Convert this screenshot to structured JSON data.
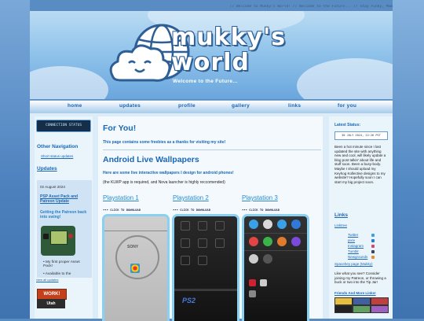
{
  "ticker": "//   Welcome to Mukky's World!   //   Welcome to the Future...   //   Stay Funky, Mam",
  "banner": {
    "logo_line1": "mukky's",
    "logo_line2": "world",
    "tagline": "Welcome to the Future..."
  },
  "nav": [
    "home",
    "updates",
    "profile",
    "gallery",
    "links",
    "for you"
  ],
  "left": {
    "status_button": "CONNECTION STATUS",
    "other_nav_heading": "Other Navigation",
    "other_nav_link": "Short status updates",
    "updates_heading": "Updates",
    "update_date": "02 August 2024",
    "update_title": "PSP Asset Pack and Patreon Update",
    "update_desc": "Getting the Patreon back into swing!",
    "update_items": [
      "My first proper Asset Pack!",
      "Available to the"
    ],
    "view_all": "view all updates",
    "badge_work": "WORK!",
    "badge_utah": "Utah"
  },
  "main": {
    "title": "For You!",
    "subtitle": "This page contains some freebies as a thanks for visiting my site!",
    "section_title": "Android Live Wallpapers",
    "section_desc": "Here are some live interactive wallpapers I design for android phones!",
    "section_note": "(the KLWP app is required, and Nova launcher is highly reccomended)",
    "wallpapers": [
      {
        "title": "Playstation 1",
        "download": "••• CLICK TO DOWNLOAD"
      },
      {
        "title": "Playstation 2",
        "download": "••• CLICK TO DOWNLOAD"
      },
      {
        "title": "Playstation 3",
        "download": "••• CLICK TO DOWNLOAD"
      }
    ],
    "ps1_brand": "SONY",
    "ps2_brand": "PS2"
  },
  "right": {
    "latest_status": "Latest Status:",
    "status_box": "30 JULY 2024, 22:26 PST",
    "status_text": "Been a hot minute since I last updated the site with anything new and cool, will likely update a blog post talkin' about life and stuff soon. Been a busy-body. Maybe I should upload my Keyhog Kollective designs to my website? Hopefully soon I can start my big project soon.",
    "links_heading": "Links",
    "linktree": "Linktree",
    "social": [
      "Twitter",
      "pixiv",
      "Instagram",
      "Tumblr",
      "Newgrounds"
    ],
    "spacehey": "Spacehey page (Mukky)",
    "support_text": "Like what you see? Consider joining my Patreon, or throwing a buck or two into the Tip Jar!",
    "friends": "Friends And More Links!"
  },
  "colors": {
    "accent": "#1a67b5",
    "link": "#2a8bd4",
    "panel": "#eaf4fb",
    "page": "#dcecf8"
  }
}
